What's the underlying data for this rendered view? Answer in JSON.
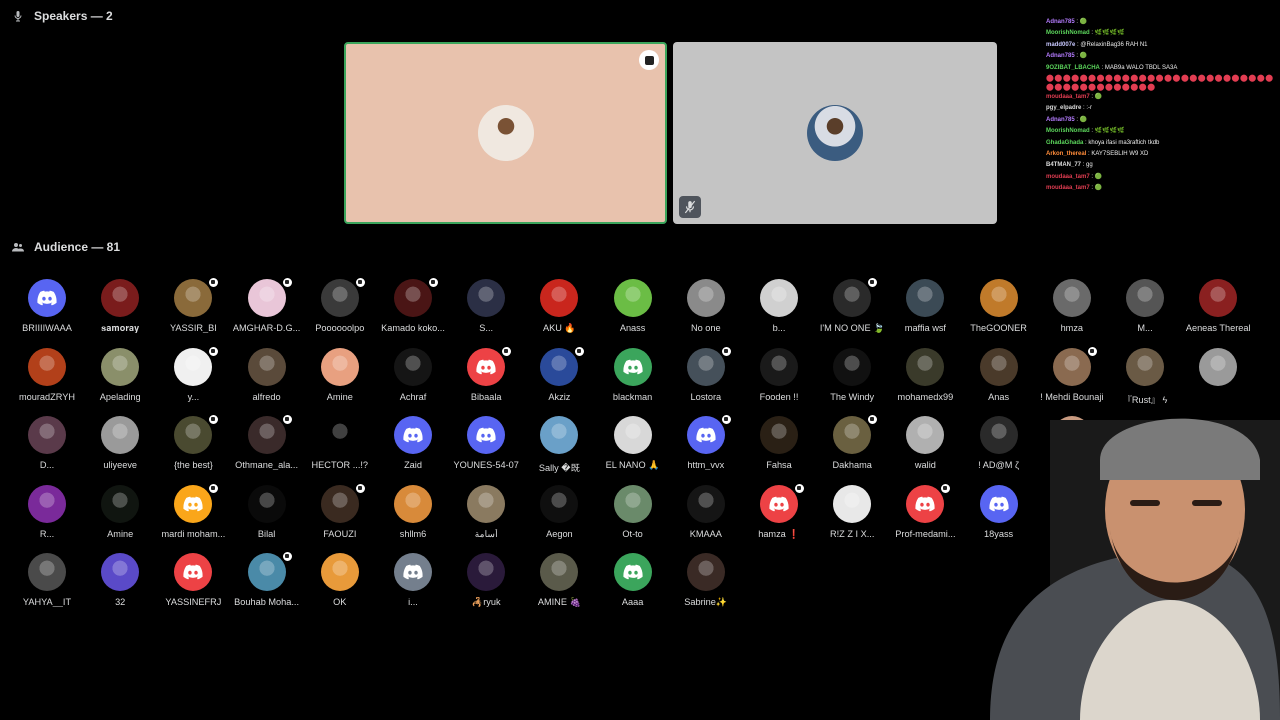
{
  "speakers": {
    "header": "Speakers — 2"
  },
  "audience": {
    "header": "Audience — 81",
    "rows": [
      [
        {
          "name": "BRIIIIWAAA",
          "kind": "discord",
          "color": "#5865f2"
        },
        {
          "name": "𝐬𝐚𝐦𝐨𝐫𝐚𝐲",
          "kind": "photo",
          "color": "#7a1c1c"
        },
        {
          "name": "YASSIR_BI",
          "kind": "photo",
          "color": "#8a6a3a",
          "badge": true
        },
        {
          "name": "AMGHAR-D.G...",
          "kind": "photo",
          "color": "#e9c6d8",
          "badge": true
        },
        {
          "name": "Poooooolpo",
          "kind": "photo",
          "color": "#3a3a3a",
          "badge": true
        },
        {
          "name": "Kamado koko...",
          "kind": "photo",
          "color": "#4a1515",
          "badge": true
        },
        {
          "name": "S...",
          "kind": "photo",
          "color": "#2b2f45"
        },
        {
          "name": "AKU 🔥",
          "kind": "photo",
          "color": "#c9261d"
        },
        {
          "name": "Anass",
          "kind": "photo",
          "color": "#6bbd45"
        },
        {
          "name": "No one",
          "kind": "photo",
          "color": "#8a8a8a"
        },
        {
          "name": "b...",
          "kind": "photo",
          "color": "#d0d0d0"
        },
        {
          "name": "I'M NO ONE 🍃",
          "kind": "photo",
          "color": "#2a2a2a",
          "badge": true
        },
        {
          "name": "maffia wsf",
          "kind": "photo",
          "color": "#3b4a55"
        },
        {
          "name": "TheGOONER",
          "kind": "photo",
          "color": "#c07a2a"
        },
        {
          "name": "hmza",
          "kind": "photo",
          "color": "#6a6a6a"
        },
        {
          "name": "M...",
          "kind": "photo",
          "color": "#555"
        },
        {
          "name": "Aeneas Thereal",
          "kind": "photo",
          "color": "#8a2020"
        }
      ],
      [
        {
          "name": "mouradZRYH",
          "kind": "photo",
          "color": "#b2401a"
        },
        {
          "name": "Apelading",
          "kind": "photo",
          "color": "#8a8f6a"
        },
        {
          "name": "y...",
          "kind": "photo",
          "color": "#f0f0f0",
          "badge": true
        },
        {
          "name": "alfredo",
          "kind": "photo",
          "color": "#5a4a3a"
        },
        {
          "name": "Amine",
          "kind": "photo",
          "color": "#e8a080"
        },
        {
          "name": "Achraf",
          "kind": "photo",
          "color": "#151515"
        },
        {
          "name": "Bibaala",
          "kind": "discord",
          "color": "#ed4245",
          "badge": true
        },
        {
          "name": "Akziz",
          "kind": "photo",
          "color": "#2a4a9a",
          "badge": true
        },
        {
          "name": "blackman",
          "kind": "discord",
          "color": "#3ba55c"
        },
        {
          "name": "Lostora",
          "kind": "photo",
          "color": "#45505a",
          "badge": true
        },
        {
          "name": "Fooden !!",
          "kind": "photo",
          "color": "#1a1a1a"
        },
        {
          "name": "The Windy",
          "kind": "photo",
          "color": "#111"
        },
        {
          "name": "mohamedx99",
          "kind": "photo",
          "color": "#3a3a2a"
        },
        {
          "name": "Anas",
          "kind": "photo",
          "color": "#4a3a2a"
        },
        {
          "name": "! Mehdi Bounaji",
          "kind": "photo",
          "color": "#8a6a50",
          "badge": true
        },
        {
          "name": "『Rust』 ϟ",
          "kind": "photo",
          "color": "#6a5a45"
        },
        {
          "name": "",
          "kind": "photo",
          "color": "#9a9a9a"
        }
      ],
      [
        {
          "name": "D...",
          "kind": "photo",
          "color": "#5a3a4a"
        },
        {
          "name": "uliyeeve",
          "kind": "photo",
          "color": "#9a9a9a"
        },
        {
          "name": "{the best}",
          "kind": "photo",
          "color": "#4a4a30",
          "badge": true
        },
        {
          "name": "Othmane_ala...",
          "kind": "photo",
          "color": "#3a2a2a",
          "badge": true
        },
        {
          "name": "HECTOR ...!?",
          "kind": "photo",
          "color": "#000"
        },
        {
          "name": "Zaid",
          "kind": "discord",
          "color": "#5865f2"
        },
        {
          "name": "YOUNES-54-07",
          "kind": "discord",
          "color": "#5865f2"
        },
        {
          "name": "Sally �既",
          "kind": "photo",
          "color": "#6aa0c8"
        },
        {
          "name": "EL NANO 🙏",
          "kind": "photo",
          "color": "#d8d8d8"
        },
        {
          "name": "httm_vvx",
          "kind": "discord",
          "color": "#5865f2",
          "badge": true
        },
        {
          "name": "Fahsa",
          "kind": "photo",
          "color": "#2a2015"
        },
        {
          "name": "Dakhama",
          "kind": "photo",
          "color": "#6a6040",
          "badge": true
        },
        {
          "name": "walid",
          "kind": "photo",
          "color": "#b0b0b0"
        },
        {
          "name": "! AD@M ζ",
          "kind": "photo",
          "color": "#2a2a2a"
        },
        {
          "name": "",
          "kind": "photo",
          "color": "#c89a80"
        }
      ],
      [
        {
          "name": "R...",
          "kind": "photo",
          "color": "#7a2a9a"
        },
        {
          "name": "Amine",
          "kind": "photo",
          "color": "#101510"
        },
        {
          "name": "mardi moham...",
          "kind": "discord",
          "color": "#faa61a",
          "badge": true
        },
        {
          "name": "Bilal",
          "kind": "photo",
          "color": "#0a0a0a"
        },
        {
          "name": "FAOUZI",
          "kind": "photo",
          "color": "#3a2a20",
          "badge": true
        },
        {
          "name": "shllm6",
          "kind": "photo",
          "color": "#d88a3a"
        },
        {
          "name": "أسامة",
          "kind": "photo",
          "color": "#8a7a60"
        },
        {
          "name": "Aegon",
          "kind": "photo",
          "color": "#0f0f0f"
        },
        {
          "name": "Ot-to",
          "kind": "photo",
          "color": "#6a8a6a"
        },
        {
          "name": "KMAAA",
          "kind": "photo",
          "color": "#151515"
        },
        {
          "name": "hamza ❗",
          "kind": "discord",
          "color": "#ed4245",
          "badge": true
        },
        {
          "name": "R!Z Z I X...",
          "kind": "photo",
          "color": "#e8e8e8"
        },
        {
          "name": "Prof-medami...",
          "kind": "discord",
          "color": "#ed4245",
          "badge": true
        },
        {
          "name": "18yass",
          "kind": "discord",
          "color": "#5865f2"
        }
      ],
      [
        {
          "name": "YAHYA__IT",
          "kind": "photo",
          "color": "#4a4a4a"
        },
        {
          "name": "32",
          "kind": "photo",
          "color": "#5a4ac8"
        },
        {
          "name": "YASSINEFRJ",
          "kind": "discord",
          "color": "#ed4245"
        },
        {
          "name": "Bouhab Moha...",
          "kind": "photo",
          "color": "#4a8aa8",
          "badge": true
        },
        {
          "name": "OK",
          "kind": "photo",
          "color": "#e89a3a"
        },
        {
          "name": "i...",
          "kind": "discord",
          "color": "#747f8d"
        },
        {
          "name": "🦂ryuk",
          "kind": "photo",
          "color": "#2a1a3a"
        },
        {
          "name": "AMINE 🍇",
          "kind": "photo",
          "color": "#5a5a4a"
        },
        {
          "name": "Aaaa",
          "kind": "discord",
          "color": "#3ba55c"
        },
        {
          "name": "Sabrine✨",
          "kind": "photo",
          "color": "#3a2a25"
        }
      ]
    ]
  },
  "chat": [
    {
      "user": "Adnan785",
      "color": "#b57cff",
      "msg": "🟢"
    },
    {
      "user": "MoorishNomad",
      "color": "#5cd65c",
      "msg": "🌿🌿🌿🌿"
    },
    {
      "user": "madd007e",
      "color": "#c8c8ff",
      "msg": "@RelaxinBag36 RAH N1"
    },
    {
      "user": "Adnan785",
      "color": "#b57cff",
      "msg": "🟢"
    },
    {
      "user": "9OZIBAT_LBACHA",
      "color": "#5cd65c",
      "msg": "MAB9a WALO TBDL SA3A"
    },
    {
      "emotes": "⬤⬤⬤⬤⬤⬤⬤⬤⬤⬤⬤⬤⬤⬤⬤⬤⬤⬤⬤⬤⬤⬤⬤⬤⬤⬤⬤⬤⬤⬤⬤⬤⬤⬤⬤⬤⬤⬤⬤⬤"
    },
    {
      "user": "moudaaa_tam7",
      "color": "#e23d52",
      "msg": "🟢"
    },
    {
      "user": "pgy_elpadre",
      "color": "#dddddd",
      "msg": ":-r"
    },
    {
      "user": "Adnan785",
      "color": "#b57cff",
      "msg": "🟢"
    },
    {
      "user": "MoorishNomad",
      "color": "#5cd65c",
      "msg": "🌿🌿🌿🌿"
    },
    {
      "user": "GhadaGhada",
      "color": "#5cd65c",
      "msg": "khoya ifasi ma3raftich tkdb"
    },
    {
      "user": "Arkon_thereal",
      "color": "#ff8c3a",
      "msg": "KAY7SEBLIH W9 XD"
    },
    {
      "user": "B4TMAN_77",
      "color": "#dddddd",
      "msg": "gg"
    },
    {
      "user": "moudaaa_tam7",
      "color": "#e23d52",
      "msg": "🟢"
    },
    {
      "user": "moudaaa_tam7",
      "color": "#e23d52",
      "msg": "🟢"
    }
  ]
}
